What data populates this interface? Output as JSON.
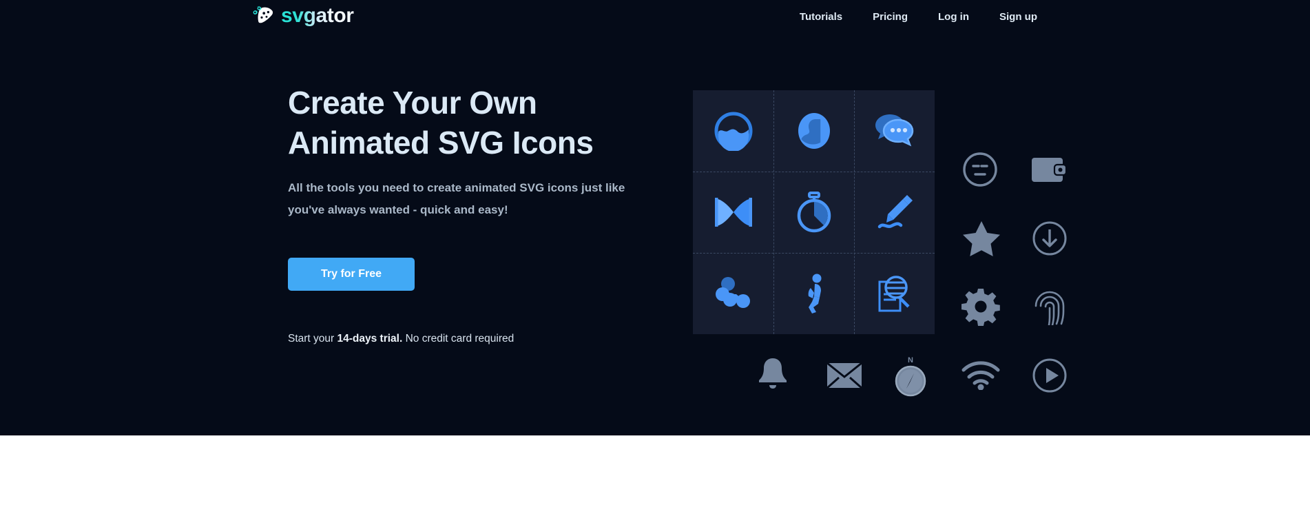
{
  "brand": {
    "logo_text": "svgator",
    "logo_mark_icon": "svgator-mask-icon",
    "logo_cyan": "#27e3d6",
    "logo_white": "#f3f9fd"
  },
  "nav": {
    "items": [
      {
        "label": "Tutorials",
        "name": "nav-tutorials"
      },
      {
        "label": "Pricing",
        "name": "nav-pricing"
      },
      {
        "label": "Log in",
        "name": "nav-login"
      },
      {
        "label": "Sign up",
        "name": "nav-signup"
      }
    ]
  },
  "hero": {
    "headline_line1": "Create Your Own",
    "headline_line2": "Animated SVG Icons",
    "subhead": "All the tools you need to create animated SVG icons just like you've always wanted - quick and easy!",
    "cta_label": "Try for Free",
    "cta_color": "#41a9f5",
    "trial_prefix": "Start your ",
    "trial_bold": "14-days trial.",
    "trial_suffix": " No credit card required",
    "background_color": "#050b18",
    "headline_color": "#dbe9f5"
  },
  "icon_grid": {
    "panel_color": "#161d30",
    "accent_color": "#3d8ef7",
    "rows": 3,
    "columns": 3,
    "cells": [
      {
        "name": "circle-fill-icon",
        "label": "Filled Circle"
      },
      {
        "name": "user-avatar-icon",
        "label": "User Avatar"
      },
      {
        "name": "chat-bubbles-icon",
        "label": "Chat Bubbles"
      },
      {
        "name": "bowtie-icon",
        "label": "Bowtie"
      },
      {
        "name": "stopwatch-icon",
        "label": "Stopwatch"
      },
      {
        "name": "pencil-draw-icon",
        "label": "Pencil Draw"
      },
      {
        "name": "molecule-icon",
        "label": "Molecule"
      },
      {
        "name": "running-person-icon",
        "label": "Running Person"
      },
      {
        "name": "search-document-icon",
        "label": "Search Document"
      }
    ]
  },
  "gray_icons": {
    "color": "#76879f",
    "items": [
      {
        "name": "neutral-face-icon",
        "label": "Neutral Face"
      },
      {
        "name": "wallet-icon",
        "label": "Wallet"
      },
      {
        "name": "star-icon",
        "label": "Star"
      },
      {
        "name": "download-circle-icon",
        "label": "Download"
      },
      {
        "name": "gear-icon",
        "label": "Settings Gear"
      },
      {
        "name": "fingerprint-icon",
        "label": "Fingerprint"
      },
      {
        "name": "bell-icon",
        "label": "Notification Bell"
      },
      {
        "name": "envelope-icon",
        "label": "Mail Envelope"
      },
      {
        "name": "compass-icon",
        "label": "Compass"
      },
      {
        "name": "wifi-icon",
        "label": "Wi-Fi"
      },
      {
        "name": "play-circle-icon",
        "label": "Play"
      }
    ],
    "compass_north_label": "N"
  }
}
